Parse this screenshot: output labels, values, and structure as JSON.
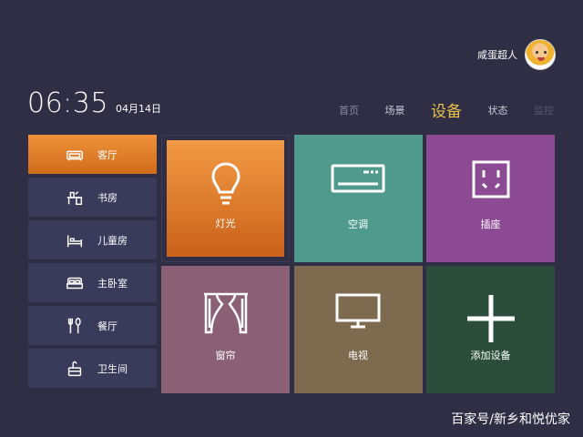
{
  "user": {
    "name": "咸蛋超人"
  },
  "clock": {
    "time": "06:35",
    "date": "04月14日"
  },
  "nav": {
    "items": [
      {
        "label": "首页"
      },
      {
        "label": "场景"
      },
      {
        "label": "设备"
      },
      {
        "label": "状态"
      },
      {
        "label": "监控"
      }
    ],
    "active": "设备"
  },
  "rooms": [
    {
      "label": "客厅",
      "icon": "sofa-icon",
      "active": true
    },
    {
      "label": "书房",
      "icon": "desk-icon"
    },
    {
      "label": "儿童房",
      "icon": "bed-icon"
    },
    {
      "label": "主卧室",
      "icon": "double-bed-icon"
    },
    {
      "label": "餐厅",
      "icon": "cutlery-icon"
    },
    {
      "label": "卫生间",
      "icon": "bathroom-icon"
    }
  ],
  "devices": [
    {
      "label": "灯光",
      "icon": "light-bulb-icon",
      "color": "#e07a2a",
      "active": true
    },
    {
      "label": "空调",
      "icon": "air-conditioner-icon",
      "color": "#4f9a8c"
    },
    {
      "label": "插座",
      "icon": "socket-icon",
      "color": "#8d4a94"
    },
    {
      "label": "窗帘",
      "icon": "curtain-icon",
      "color": "#8b5f74"
    },
    {
      "label": "电视",
      "icon": "tv-icon",
      "color": "#7e6a4e"
    },
    {
      "label": "添加设备",
      "icon": "plus-icon",
      "color": "#2c4d3c"
    }
  ],
  "watermark": "百家号/新乡和悦优家",
  "colors": {
    "background": "#2f2e45",
    "sidebar_item": "#3a3a5a",
    "accent": "#e8c04a",
    "active_orange": "#e07a2a"
  }
}
